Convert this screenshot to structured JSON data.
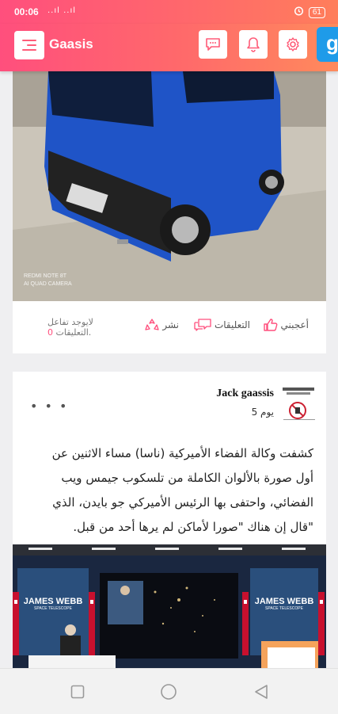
{
  "status_bar": {
    "time": "00:06",
    "signal": "..ıl ..ıl",
    "battery": "61"
  },
  "app": {
    "title": "Gaasis",
    "side_chip": "g"
  },
  "post1": {
    "camera_watermark_line1": "REDMI NOTE 8T",
    "camera_watermark_line2": "AI QUAD CAMERA",
    "actions": {
      "like": "أعجبني",
      "comment": "التعليقات",
      "share": "نشر"
    },
    "no_comments_line1": "لايوجد تفاعل",
    "no_comments_count": "0",
    "no_comments_line2": "التعليقات."
  },
  "post2": {
    "author": "Jack gaassis",
    "time_ago": "5 يوم",
    "text": "كشفت وكالة الفضاء الأميركية (ناسا) مساء الاثنين عن أول صورة بالألوان الكاملة من تلسكوب جيمس ويب الفضائي، واحتفى بها الرئيس الأميركي جو بايدن، الذي \"قال إن هناك \"صورا لأماكن لم يرها أحد من قبل.",
    "banner_left": "JAMES WEBB",
    "banner_left_sub": "SPACE TELESCOPE",
    "banner_right": "JAMES WEBB",
    "banner_right_sub": "SPACE TELESCOPE"
  },
  "colors": {
    "accent": "#ff4f7d",
    "accent2": "#ff8a5c",
    "chip": "#1e9be9"
  },
  "icons": [
    "menu-icon",
    "chat-icon",
    "bell-icon",
    "gear-icon",
    "like-icon",
    "comment-icon",
    "share-icon",
    "more-icon",
    "square-nav-icon",
    "circle-nav-icon",
    "back-nav-icon"
  ]
}
